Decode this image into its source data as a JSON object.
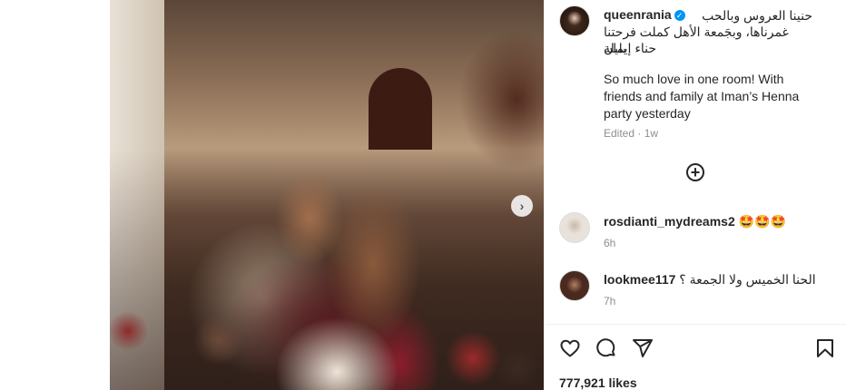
{
  "post": {
    "username": "queenrania",
    "caption_ar_line1": "حنينا العروس وبالحب",
    "caption_ar_line2": "غمرناها، وبجَمعة الأهل كملت فرحتنا بليلة",
    "caption_ar_line3": "حناء إيمان",
    "caption_en_line1": "So much love in one room! With",
    "caption_en_line2": "friends and family at Iman’s Henna",
    "caption_en_line3": "party yesterday",
    "edited_label": "Edited",
    "time": "1w",
    "likes": "777,921 likes"
  },
  "comments": [
    {
      "username": "rosdianti_mydreams2",
      "text": "🤩🤩🤩",
      "time": "6h"
    },
    {
      "username": "lookmee117",
      "text": "الحنا الخميس ولا الجمعة ؟",
      "time": "7h"
    }
  ],
  "icons": {
    "verified": "verified-badge-icon",
    "add": "plus-circle-icon",
    "like": "heart-icon",
    "comment": "comment-bubble-icon",
    "share": "paper-plane-icon",
    "save": "bookmark-icon",
    "next": "chevron-right-icon"
  },
  "colors": {
    "verified": "#0095f6",
    "muted": "#8e8e8e",
    "text": "#262626"
  }
}
